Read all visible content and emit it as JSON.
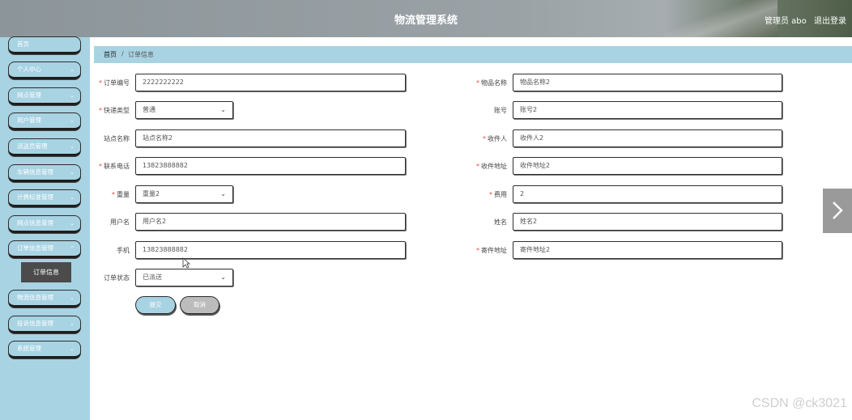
{
  "header": {
    "title": "物流管理系统",
    "user_label": "管理员 abo",
    "logout_label": "退出登录"
  },
  "sidebar": {
    "items": [
      {
        "label": "首页",
        "has_children": false
      },
      {
        "label": "个人中心",
        "has_children": true
      },
      {
        "label": "网点管理",
        "has_children": true
      },
      {
        "label": "用户管理",
        "has_children": true
      },
      {
        "label": "派送员管理",
        "has_children": true
      },
      {
        "label": "车辆信息管理",
        "has_children": true
      },
      {
        "label": "计费标准管理",
        "has_children": true
      },
      {
        "label": "网点信息管理",
        "has_children": true
      },
      {
        "label": "订单信息管理",
        "has_children": true
      },
      {
        "label": "物流信息管理",
        "has_children": true
      },
      {
        "label": "投诉信息管理",
        "has_children": true
      },
      {
        "label": "系统管理",
        "has_children": true
      }
    ],
    "submenu": {
      "label": "订单信息"
    }
  },
  "breadcrumb": {
    "home": "首页",
    "separator": "/",
    "current": "订单信息"
  },
  "form": {
    "order_no": {
      "label": "订单编号",
      "value": "2222222222",
      "required": true
    },
    "item_name": {
      "label": "物品名称",
      "value": "物品名称2",
      "required": true
    },
    "express_type": {
      "label": "快递类型",
      "value": "普通",
      "required": true
    },
    "account": {
      "label": "账号",
      "value": "账号2",
      "required": false
    },
    "station_name": {
      "label": "站点名称",
      "value": "站点名称2",
      "required": false
    },
    "receiver": {
      "label": "收件人",
      "value": "收件人2",
      "required": true
    },
    "contact_phone": {
      "label": "联系电话",
      "value": "13823888882",
      "required": true
    },
    "receiver_address": {
      "label": "收件地址",
      "value": "收件地址2",
      "required": true
    },
    "weight": {
      "label": "重量",
      "value": "重量2",
      "required": true
    },
    "fee": {
      "label": "费用",
      "value": "2",
      "required": true
    },
    "username": {
      "label": "用户名",
      "value": "用户名2",
      "required": false
    },
    "name": {
      "label": "姓名",
      "value": "姓名2",
      "required": false
    },
    "mobile": {
      "label": "手机",
      "value": "13823888882",
      "required": false
    },
    "sender_address": {
      "label": "寄件地址",
      "value": "寄件地址2",
      "required": true
    },
    "order_status": {
      "label": "订单状态",
      "value": "已派送",
      "required": false
    }
  },
  "buttons": {
    "submit": "提交",
    "cancel": "取消"
  },
  "watermark": "CSDN @ck3021"
}
